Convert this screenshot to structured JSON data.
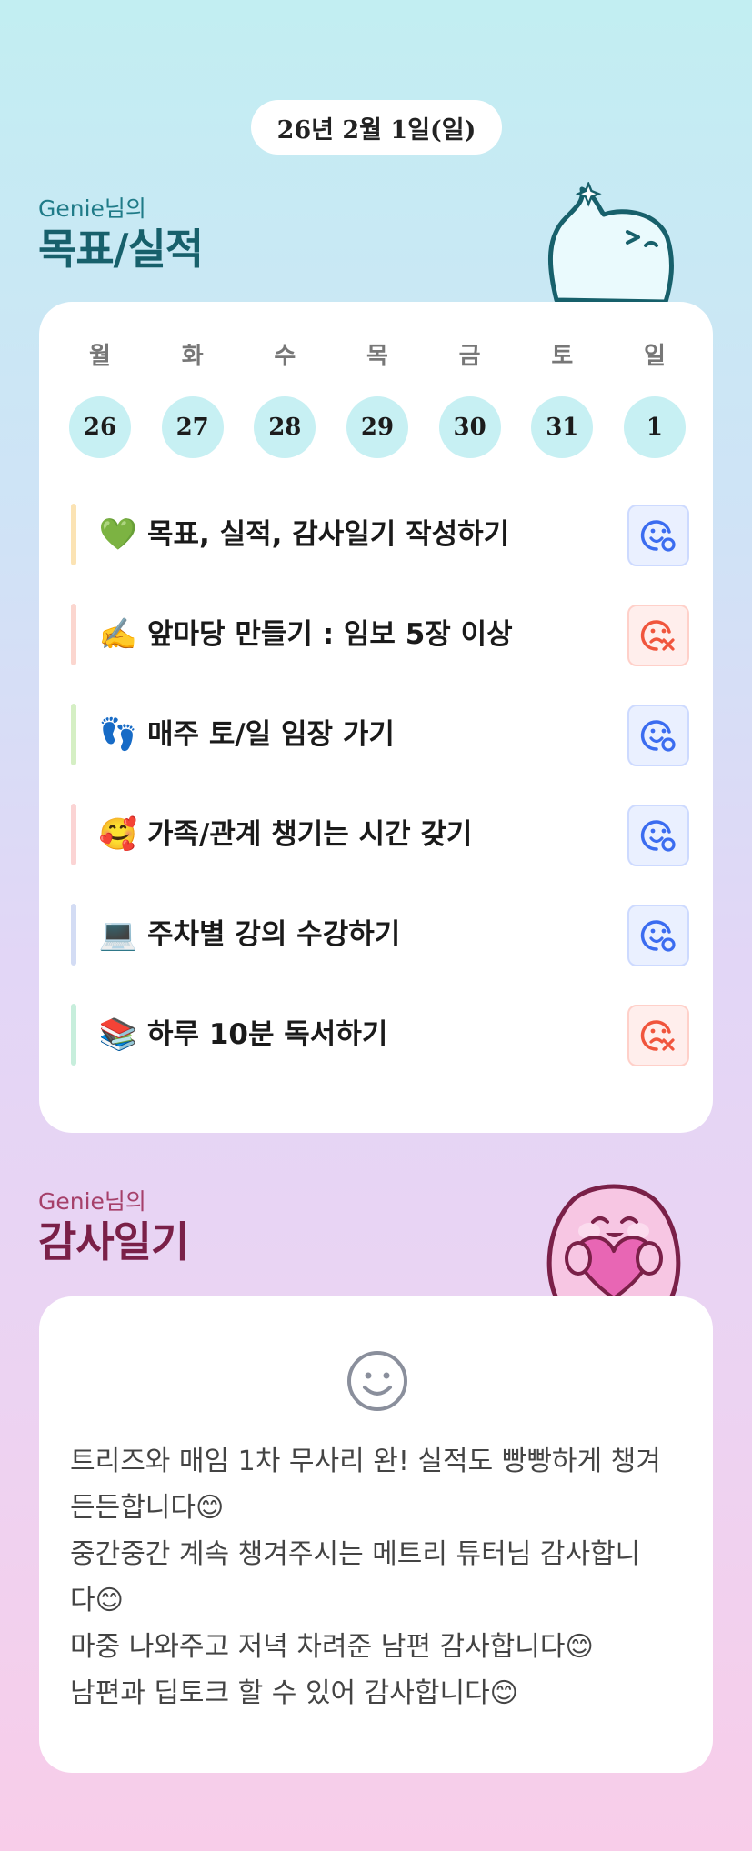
{
  "date_label": "26년 2월 1일(일)",
  "goals_section": {
    "subtitle": "Genie님의",
    "title": "목표/실적",
    "weekdays": [
      "월",
      "화",
      "수",
      "목",
      "금",
      "토",
      "일"
    ],
    "dates": [
      "26",
      "27",
      "28",
      "29",
      "30",
      "31",
      "1"
    ],
    "goals": [
      {
        "emoji": "💚",
        "text": "목표, 실적, 감사일기 작성하기",
        "status": "achieved",
        "bar_color": "#fbe3b4"
      },
      {
        "emoji": "✍️",
        "text": "앞마당 만들기 : 임보 5장 이상",
        "status": "missed",
        "bar_color": "#fbd6cf"
      },
      {
        "emoji": "👣",
        "text": "매주 토/일 임장 가기",
        "status": "achieved",
        "bar_color": "#d5efc4"
      },
      {
        "emoji": "🥰",
        "text": "가족/관계 챙기는 시간 갖기",
        "status": "achieved",
        "bar_color": "#fbd4d4"
      },
      {
        "emoji": "💻",
        "text": "주차별 강의 수강하기",
        "status": "achieved",
        "bar_color": "#d3dcf4"
      },
      {
        "emoji": "📚",
        "text": "하루 10분 독서하기",
        "status": "missed",
        "bar_color": "#c7eedc"
      }
    ],
    "status_icons": {
      "achieved": "smile-check-icon",
      "missed": "sad-x-icon"
    },
    "colors": {
      "achieved": "#3b6cf0",
      "missed": "#f0553d"
    }
  },
  "gratitude_section": {
    "subtitle": "Genie님의",
    "title": "감사일기",
    "lines": [
      "트리즈와 매임 1차 무사리 완! 실적도 빵빵하게 챙겨",
      "든든합니다😊",
      "중간중간 계속 챙겨주시는 메트리 튜터님 감사합니",
      "다😊",
      "마중 나와주고 저녁 차려준 남편 감사합니다😊",
      "남편과 딥토크 할 수 있어 감사합니다😊"
    ]
  }
}
